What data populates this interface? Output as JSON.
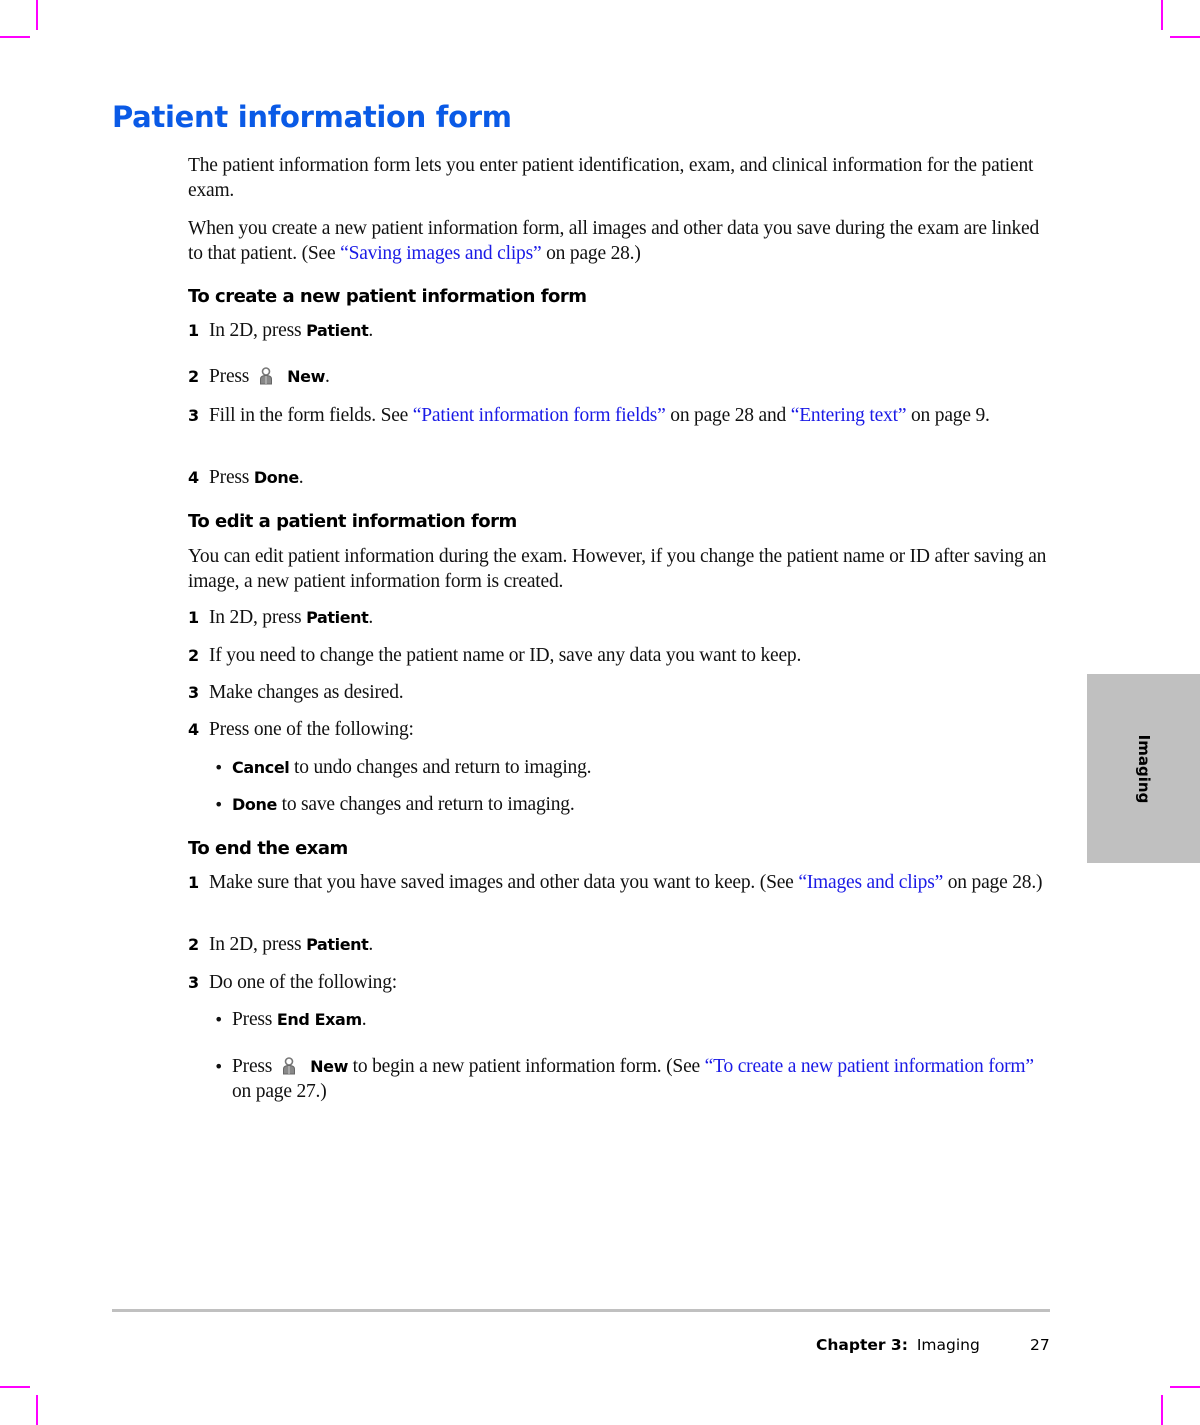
{
  "page": {
    "title": "Patient information form",
    "intro": [
      {
        "parts": [
          {
            "text": "The patient information form lets you enter patient identification, exam, and clinical information for the patient exam."
          }
        ]
      },
      {
        "parts": [
          {
            "text": "When you create a new patient information form, all images and other data you save during the exam are linked to that patient. (See "
          },
          {
            "link": "“Saving images and clips”"
          },
          {
            "text": " on page 28.)"
          }
        ]
      }
    ],
    "sections": [
      {
        "heading": "To create a new patient information form",
        "steps": [
          {
            "num": "1",
            "pre": "In 2D, press ",
            "kw": "Patient",
            "post": "."
          },
          {
            "num": "2",
            "pre": "Press",
            "icon": "user-icon",
            "kw": "New",
            "post": "."
          },
          {
            "num": "3",
            "pre": "Fill in the form fields. See ",
            "link1": "“Patient information form fields”",
            "mid": " on page 28 and ",
            "link2": "“Entering text”",
            "post": " on page 9."
          },
          {
            "num": "4",
            "pre": "Press ",
            "kw": "Done",
            "post": "."
          }
        ]
      },
      {
        "heading": "To edit a patient information form",
        "intro": "You can edit patient information during the exam. However, if you change the patient name or ID after saving an image, a new patient information form is created.",
        "steps": [
          {
            "num": "1",
            "pre": "In 2D, press ",
            "kw": "Patient",
            "post": "."
          },
          {
            "num": "2",
            "pre": "If you need to change the patient name or ID, save any data you want to keep."
          },
          {
            "num": "3",
            "pre": "Make changes as desired."
          },
          {
            "num": "4",
            "pre": "Press one of the following:"
          }
        ],
        "bullets": [
          {
            "kw": "Cancel",
            "post": " to undo changes and return to imaging."
          },
          {
            "kw": "Done",
            "post": " to save changes and return to imaging."
          }
        ]
      },
      {
        "heading": "To end the exam",
        "steps": [
          {
            "num": "1",
            "pre": "Make sure that you have saved images and other data you want to keep. (See ",
            "link1": "“Images and clips”",
            "post": " on page 28.)"
          },
          {
            "num": "2",
            "pre": "In 2D, press ",
            "kw": "Patient",
            "post": "."
          },
          {
            "num": "3",
            "pre": "Do one of the following:"
          }
        ],
        "bullets": [
          {
            "pre": "Press ",
            "kw": "End Exam",
            "post": "."
          },
          {
            "pre": "Press",
            "icon": "user-icon",
            "kw": "New",
            "mid": " to begin a new patient information form. (See ",
            "link1": "“To create a new patient information form”",
            "post": " on page 27.)"
          }
        ]
      }
    ]
  },
  "side_tab": {
    "label": "Imaging"
  },
  "footer": {
    "chapter": "Chapter 3:",
    "chapter_name": "Imaging",
    "page_number": "27"
  },
  "colors": {
    "title": "#0a5ae6",
    "link": "#1a1ae6",
    "tab": "#c0c0c0",
    "crop_marks": "#ff00ff"
  }
}
